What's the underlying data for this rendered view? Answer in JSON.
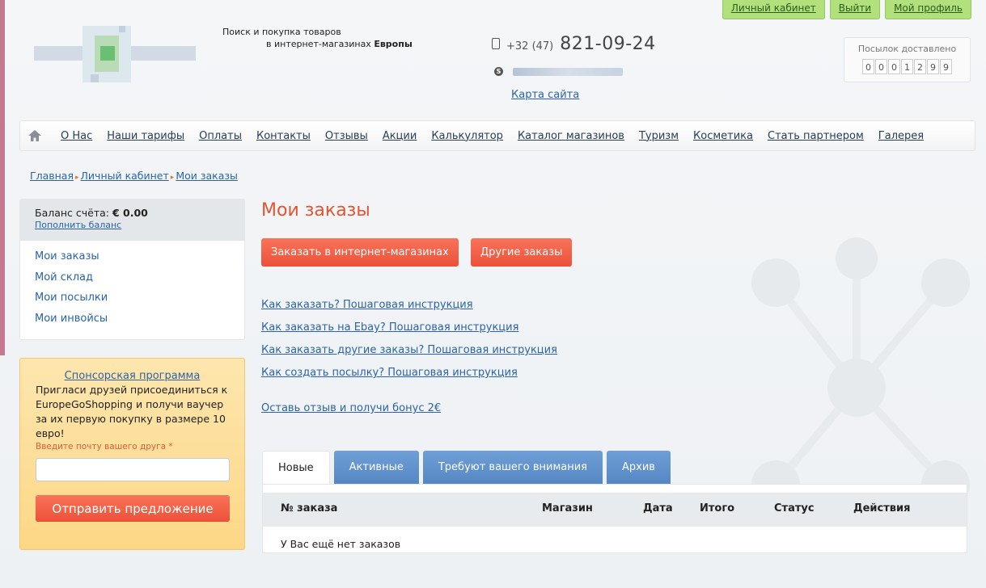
{
  "header": {
    "tagline_line1": "Поиск и покупка товаров",
    "tagline_line2_prefix": "в интернет-магазинах ",
    "tagline_line2_bold": "Европы",
    "phone_code": "+32 (47)",
    "phone_number": "821-09-24",
    "sitemap_link": "Карта сайта"
  },
  "top_buttons": {
    "cabinet": "Личный кабинет",
    "logout": "Выйти",
    "profile": "Мой профиль"
  },
  "counter": {
    "label": "Посылок доставлено",
    "digits": [
      "0",
      "0",
      "0",
      "1",
      "2",
      "9",
      "9"
    ]
  },
  "nav": {
    "items": [
      "О Нас",
      "Наши тарифы",
      "Оплаты",
      "Контакты",
      "Отзывы",
      "Акции",
      "Калькулятор",
      "Каталог магазинов",
      "Туризм",
      "Косметика",
      "Стать партнером",
      "Галерея"
    ]
  },
  "breadcrumb": {
    "home": "Главная",
    "cabinet": "Личный кабинет",
    "current": "Мои заказы"
  },
  "sidebar": {
    "balance_label": "Баланс счёта: ",
    "balance_value": "€ 0.00",
    "topup_link": "Пополнить баланс",
    "menu": [
      "Мои заказы",
      "Мой склад",
      "Мои посылки",
      "Мои инвойсы"
    ]
  },
  "sponsor": {
    "title": "Спонсорская программа",
    "text": "Пригласи друзей присоединиться к EuropeGoShopping и получи ваучер за их первую покупку в размере 10 евро!",
    "hint": "Введите почту вашего друга",
    "required_mark": "*",
    "email_value": "",
    "send_button": "Отправить предложение"
  },
  "main": {
    "title": "Мои заказы",
    "order_button": "Заказать в интернет-магазинах",
    "other_button": "Другие заказы",
    "guides": [
      "Как заказать? Пошаговая инструкция",
      "Как заказать на Ebay? Пошаговая инструкция",
      "Как заказать другие заказы? Пошаговая инструкция",
      "Как создать посылку? Пошаговая инструкция"
    ],
    "feedback_link": "Оставь отзыв и получи бонус 2€"
  },
  "tabs": [
    "Новые",
    "Активные",
    "Требуют вашего внимания",
    "Архив"
  ],
  "orders_table": {
    "columns": [
      "№ заказа",
      "Магазин",
      "Дата",
      "Итого",
      "Статус",
      "Действия"
    ],
    "empty_message": "У Вас ещё нет заказов"
  },
  "colors": {
    "accent_orange": "#ec5139",
    "link_blue": "#2a64a8",
    "tab_blue": "#5587c4",
    "top_button_green": "#b2e07d"
  }
}
